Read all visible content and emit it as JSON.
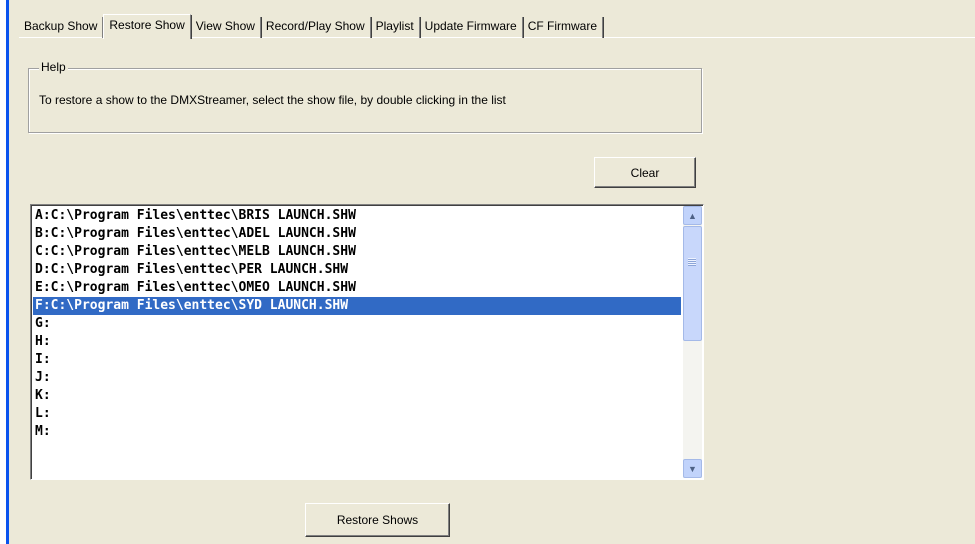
{
  "tabs": [
    {
      "label": "Backup Show",
      "active": false
    },
    {
      "label": "Restore Show",
      "active": true
    },
    {
      "label": "View Show",
      "active": false
    },
    {
      "label": "Record/Play Show",
      "active": false
    },
    {
      "label": "Playlist",
      "active": false
    },
    {
      "label": "Update Firmware",
      "active": false
    },
    {
      "label": "CF Firmware",
      "active": false
    }
  ],
  "help": {
    "legend": "Help",
    "text": "To restore a show to the DMXStreamer, select the show file, by double clicking in the list"
  },
  "clear_button": "Clear",
  "restore_button": "Restore Shows",
  "show_list": {
    "selected_index": 5,
    "items": [
      "A:C:\\Program Files\\enttec\\BRIS LAUNCH.SHW",
      "B:C:\\Program Files\\enttec\\ADEL LAUNCH.SHW",
      "C:C:\\Program Files\\enttec\\MELB LAUNCH.SHW",
      "D:C:\\Program Files\\enttec\\PER LAUNCH.SHW",
      "E:C:\\Program Files\\enttec\\OMEO LAUNCH.SHW",
      "F:C:\\Program Files\\enttec\\SYD LAUNCH.SHW",
      "G:",
      "H:",
      "I:",
      "J:",
      "K:",
      "L:",
      "M:"
    ]
  },
  "colors": {
    "background": "#ece9d8",
    "selection": "#316ac5",
    "accent_left_bar": "#0a53ee"
  }
}
